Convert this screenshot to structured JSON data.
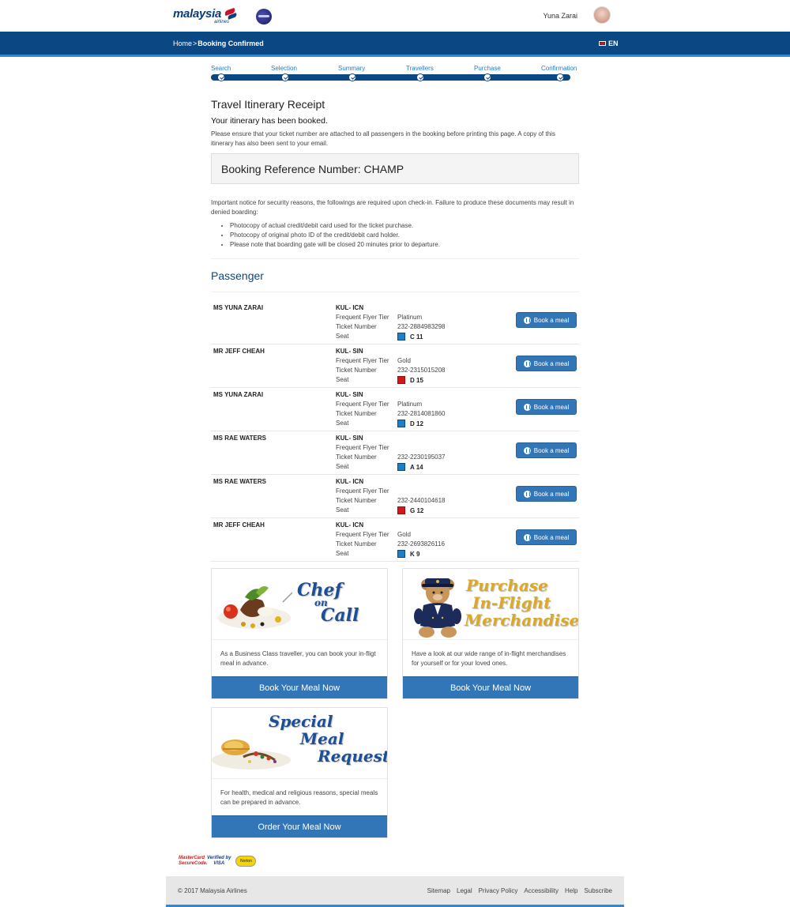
{
  "header": {
    "brand": "malaysia",
    "brand_sub": "airlines",
    "user_name": "Yuna Zarai"
  },
  "nav": {
    "home": "Home",
    "separator": ">",
    "current": "Booking Confirmed",
    "language": "EN"
  },
  "steps": [
    "Search",
    "Selection",
    "Summary",
    "Travellers",
    "Purchase",
    "Confirmation"
  ],
  "receipt": {
    "title": "Travel Itinerary Receipt",
    "subtitle": "Your itinerary has been booked.",
    "note": "Please ensure that your ticket number are attached to all passengers in the booking before printing this page. A copy of this itinerary has also been sent to your email.",
    "reference": "Booking Reference Number: CHAMP"
  },
  "notice": {
    "text": "Important notice for security reasons, the followings are required upon check-in. Failure to produce these documents may result in denied boarding:",
    "items": [
      "Photocopy of actual credit/debit card used for the ticket purchase.",
      "Photocopy of original photo ID of the credit/debit card holder.",
      "Please note that boarding gate will be closed 20 minutes prior to departure."
    ]
  },
  "passenger_heading": "Passenger",
  "labels": {
    "tier": "Frequent Flyer Tier",
    "ticket": "Ticket Number",
    "seat": "Seat",
    "book_meal": "Book a meal"
  },
  "passengers": [
    {
      "name": "MS YUNA ZARAI",
      "route": "KUL- ICN",
      "tier": "Platinum",
      "ticket": "232-2884983298",
      "seat": "C 11",
      "seat_color": "blue"
    },
    {
      "name": "MR JEFF CHEAH",
      "route": "KUL- SIN",
      "tier": "Gold",
      "ticket": "232-2315015208",
      "seat": "D 15",
      "seat_color": "red"
    },
    {
      "name": "MS YUNA ZARAI",
      "route": "KUL- SIN",
      "tier": "Platinum",
      "ticket": "232-2814081860",
      "seat": "D 12",
      "seat_color": "blue"
    },
    {
      "name": "MS RAE WATERS",
      "route": "KUL- SIN",
      "tier": "",
      "ticket": "232-2230195037",
      "seat": "A 14",
      "seat_color": "blue"
    },
    {
      "name": "MS RAE WATERS",
      "route": "KUL- ICN",
      "tier": "",
      "ticket": "232-2440104618",
      "seat": "G 12",
      "seat_color": "red"
    },
    {
      "name": "MR JEFF CHEAH",
      "route": "KUL- ICN",
      "tier": "Gold",
      "ticket": "232-2693826116",
      "seat": "K 9",
      "seat_color": "blue"
    }
  ],
  "promos": {
    "chef": {
      "title_1": "Chef",
      "title_2": "on",
      "title_3": "Call",
      "text": "As a Business Class traveller, you can book your in-fligt meal in advance.",
      "button": "Book Your Meal Now"
    },
    "merch": {
      "title_1": "Purchase",
      "title_2": "In-Flight",
      "title_3": "Merchandise",
      "text": "Have a look at our wide range of in-flight merchandises for yourself or for your loved ones.",
      "button": "Book Your Meal Now"
    },
    "special": {
      "title_1": "Special",
      "title_2": "Meal",
      "title_3": "Request",
      "text": "For health, medical and religious reasons, special meals can be prepared in advance.",
      "button": "Order Your Meal Now"
    }
  },
  "payments": {
    "mastercard": "MasterCard SecureCode.",
    "visa_1": "Verified by",
    "visa_2": "VISA",
    "norton": "Norton"
  },
  "footer": {
    "copyright": "© 2017 Malaysia Airlines",
    "links": [
      "Sitemap",
      "Legal",
      "Privacy Policy",
      "Accessibility",
      "Help",
      "Subscribe"
    ]
  },
  "colors": {
    "navy": "#0b4783",
    "accent": "#2a8ad8",
    "button": "#3276b8",
    "seat_blue": "#1e7fc4",
    "seat_red": "#d01818"
  }
}
